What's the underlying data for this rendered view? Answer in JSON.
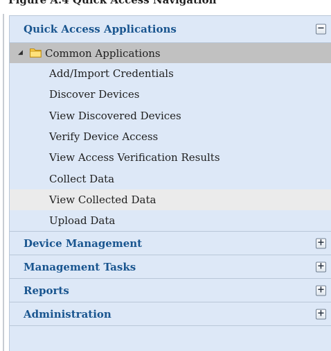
{
  "top_caption": "Figure A.4 Quick Access Navigation",
  "sections": [
    {
      "title": "Quick Access Applications",
      "toggle": "−",
      "expanded": true
    },
    {
      "title": "Device Management",
      "toggle": "+",
      "expanded": false
    },
    {
      "title": "Management Tasks",
      "toggle": "+",
      "expanded": false
    },
    {
      "title": "Reports",
      "toggle": "+",
      "expanded": false
    },
    {
      "title": "Administration",
      "toggle": "+",
      "expanded": false
    }
  ],
  "tree": {
    "root_label": "Common Applications",
    "arrow": "◢",
    "root_icon": "folder-icon",
    "items": [
      "Add/Import Credentials",
      "Discover Devices",
      "View Discovered Devices",
      "Verify Device Access",
      "View Access Verification Results",
      "Collect Data",
      "View Collected Data",
      "Upload Data"
    ],
    "selected_item": "View Collected Data"
  },
  "colors": {
    "panel_bg": "#dde8f7",
    "header_text": "#19558f",
    "tree_root_bg": "#c1c1c1",
    "selected_bg": "#ebebeb",
    "border": "#b9c7d8"
  }
}
